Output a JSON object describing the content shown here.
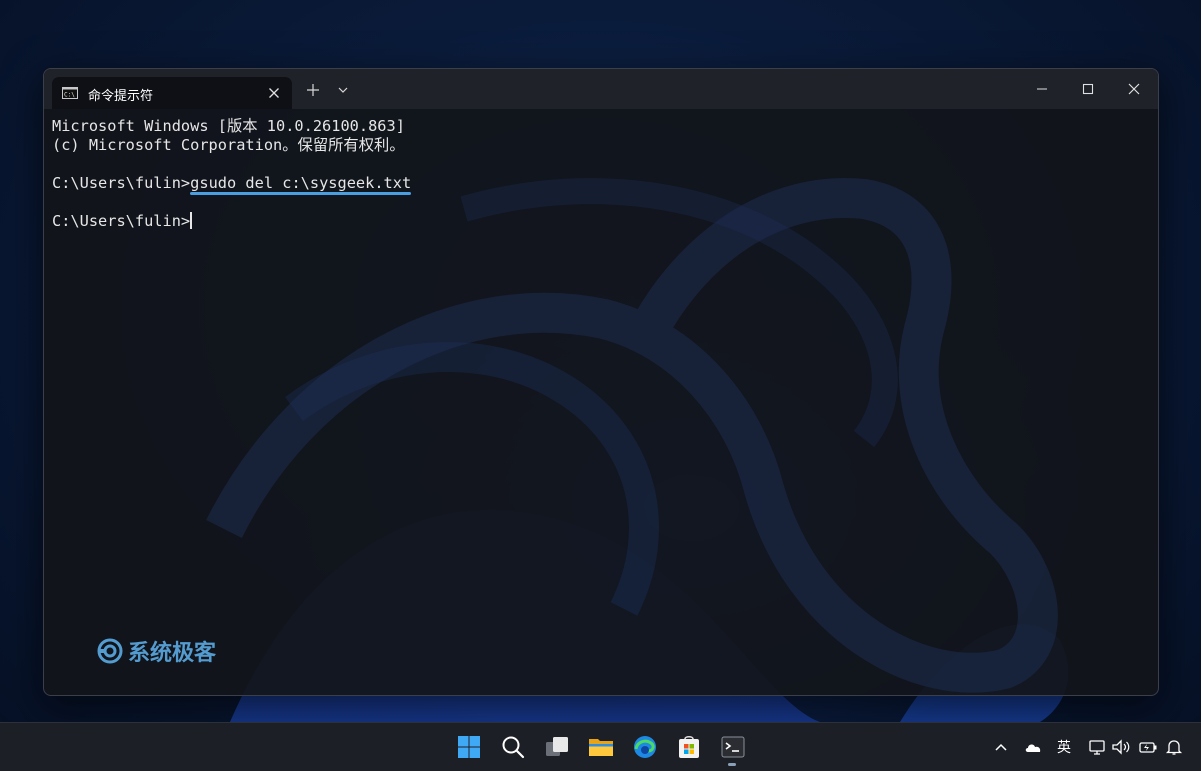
{
  "window": {
    "tab_title": "命令提示符",
    "tab_icon": "cmd-icon",
    "controls": [
      "minimize-icon",
      "maximize-icon",
      "close-icon"
    ]
  },
  "console": {
    "line1": "Microsoft Windows [版本 10.0.26100.863]",
    "line2": "(c) Microsoft Corporation。保留所有权利。",
    "prompt1": "C:\\Users\\fulin>",
    "command1": "gsudo del c:\\sysgeek.txt",
    "prompt2": "C:\\Users\\fulin>"
  },
  "watermark": {
    "text": "系统极客"
  },
  "taskbar": {
    "apps": [
      "start-icon",
      "search-icon",
      "task-view-icon",
      "file-explorer-icon",
      "edge-icon",
      "store-icon",
      "terminal-icon"
    ],
    "tray": {
      "ime": "英",
      "icons": [
        "chevron-up-icon",
        "onedrive-icon",
        "network-icon",
        "volume-icon",
        "battery-icon",
        "notification-icon"
      ]
    }
  },
  "colors": {
    "accent_underline": "#4a9fe0",
    "watermark": "#5aa8e0"
  }
}
